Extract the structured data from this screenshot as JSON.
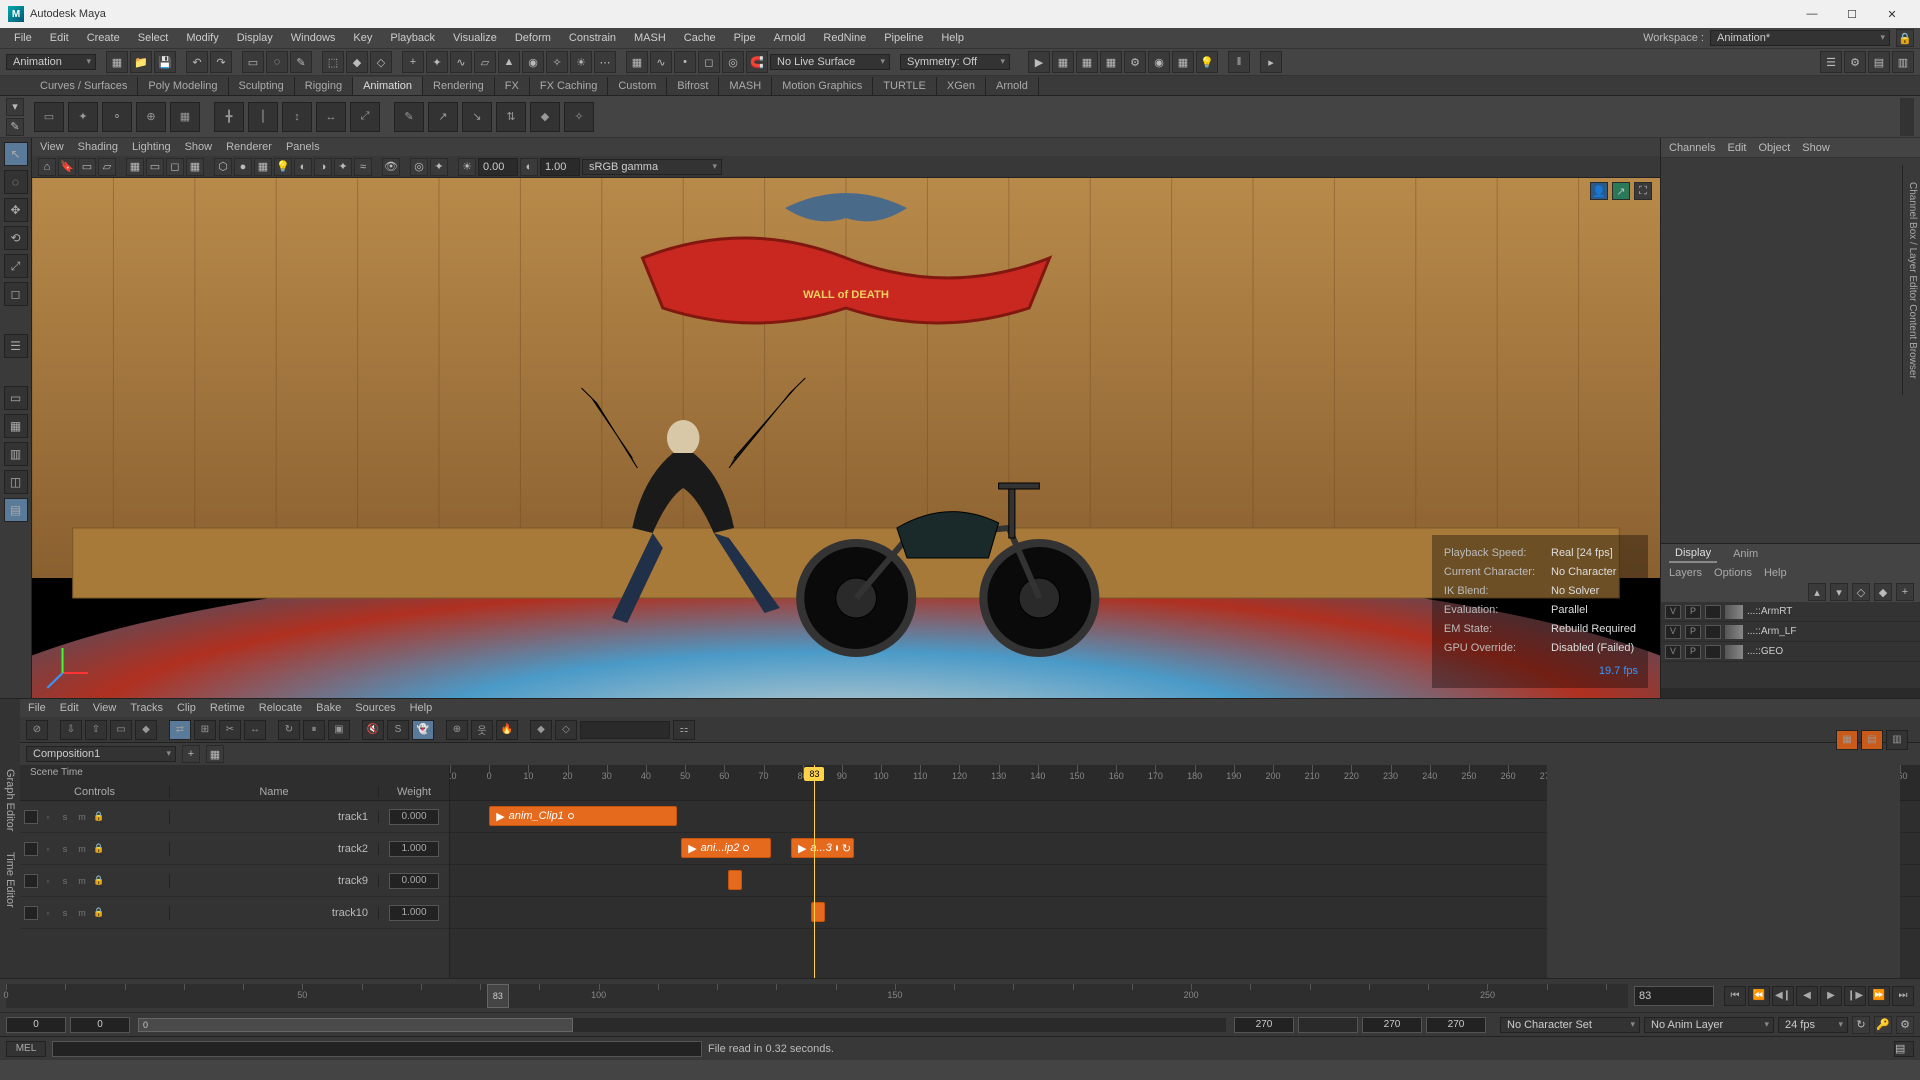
{
  "title": "Autodesk Maya",
  "mainmenu": [
    "File",
    "Edit",
    "Create",
    "Select",
    "Modify",
    "Display",
    "Windows",
    "Key",
    "Playback",
    "Visualize",
    "Deform",
    "Constrain",
    "MASH",
    "Cache",
    "Pipe",
    "Arnold",
    "RedNine",
    "Pipeline",
    "Help"
  ],
  "workspace_label": "Workspace :",
  "workspace_value": "Animation*",
  "module_dd": "Animation",
  "statusbar": {
    "noLive": "No Live Surface",
    "symmetry": "Symmetry: Off"
  },
  "shelftabs": [
    "Curves / Surfaces",
    "Poly Modeling",
    "Sculpting",
    "Rigging",
    "Animation",
    "Rendering",
    "FX",
    "FX Caching",
    "Custom",
    "Bifrost",
    "MASH",
    "Motion Graphics",
    "TURTLE",
    "XGen",
    "Arnold"
  ],
  "shelftab_active": 4,
  "vpmenu": [
    "View",
    "Shading",
    "Lighting",
    "Show",
    "Renderer",
    "Panels"
  ],
  "vp_num1": "0.00",
  "vp_num2": "1.00",
  "vp_gamma": "sRGB gamma",
  "hud": {
    "rows": [
      [
        "Playback Speed:",
        "Real [24 fps]"
      ],
      [
        "Current Character:",
        "No Character"
      ],
      [
        "IK Blend:",
        "No Solver"
      ],
      [
        "Evaluation:",
        "Parallel"
      ],
      [
        "EM State:",
        "Rebuild Required"
      ],
      [
        "GPU Override:",
        "Disabled (Failed)"
      ]
    ],
    "fps": "19.7 fps"
  },
  "chbox_menu": [
    "Channels",
    "Edit",
    "Object",
    "Show"
  ],
  "layer_tabs": [
    "Display",
    "Anim"
  ],
  "layer_opts": [
    "Layers",
    "Options",
    "Help"
  ],
  "layers": [
    {
      "v": "V",
      "p": "P",
      "name": "...::ArmRT"
    },
    {
      "v": "V",
      "p": "P",
      "name": "...::Arm_LF"
    },
    {
      "v": "V",
      "p": "P",
      "name": "...::GEO"
    }
  ],
  "rtab_label": "Channel Box / Layer Editor    Content Browser",
  "te": {
    "tabs": [
      "Graph Editor",
      "Time Editor"
    ],
    "menu": [
      "File",
      "Edit",
      "View",
      "Tracks",
      "Clip",
      "Retime",
      "Relocate",
      "Bake",
      "Sources",
      "Help"
    ],
    "compo": "Composition1",
    "scenetime": "Scene Time",
    "col_controls": "Controls",
    "col_name": "Name",
    "col_weight": "Weight",
    "tracks": [
      {
        "name": "track1",
        "weight": "0.000"
      },
      {
        "name": "track2",
        "weight": "1.000"
      },
      {
        "name": "track9",
        "weight": "0.000"
      },
      {
        "name": "track10",
        "weight": "1.000"
      }
    ],
    "ruler": {
      "start": -10,
      "end": 360,
      "step": 10,
      "visible_end": 270
    },
    "playhead": 83,
    "clips": [
      {
        "track": 0,
        "start": 0,
        "end": 48,
        "label": "anim_Clip1",
        "play": true,
        "hasEnd": true
      },
      {
        "track": 1,
        "start": 49,
        "end": 72,
        "label": "ani...ip2",
        "play": true,
        "hasEnd": true
      },
      {
        "track": 1,
        "start": 77,
        "end": 93,
        "label": "a...3",
        "play": true,
        "hasEnd": true,
        "loop": true
      },
      {
        "track": 2,
        "start": 61,
        "end": 63,
        "label": "",
        "play": false
      },
      {
        "track": 3,
        "start": 82,
        "end": 84,
        "label": "",
        "play": false
      }
    ]
  },
  "timeslider": {
    "start": 0,
    "end": 270,
    "step": 10,
    "current": 83,
    "frameField": "83"
  },
  "range": {
    "a": "0",
    "b": "0",
    "c": "0",
    "d": "270",
    "e": "270",
    "f": "270"
  },
  "range_right": {
    "charset": "No Character Set",
    "animlayer": "No Anim Layer",
    "fps": "24 fps"
  },
  "cmd": {
    "lang": "MEL",
    "msg": "File read in  0.32 seconds."
  }
}
